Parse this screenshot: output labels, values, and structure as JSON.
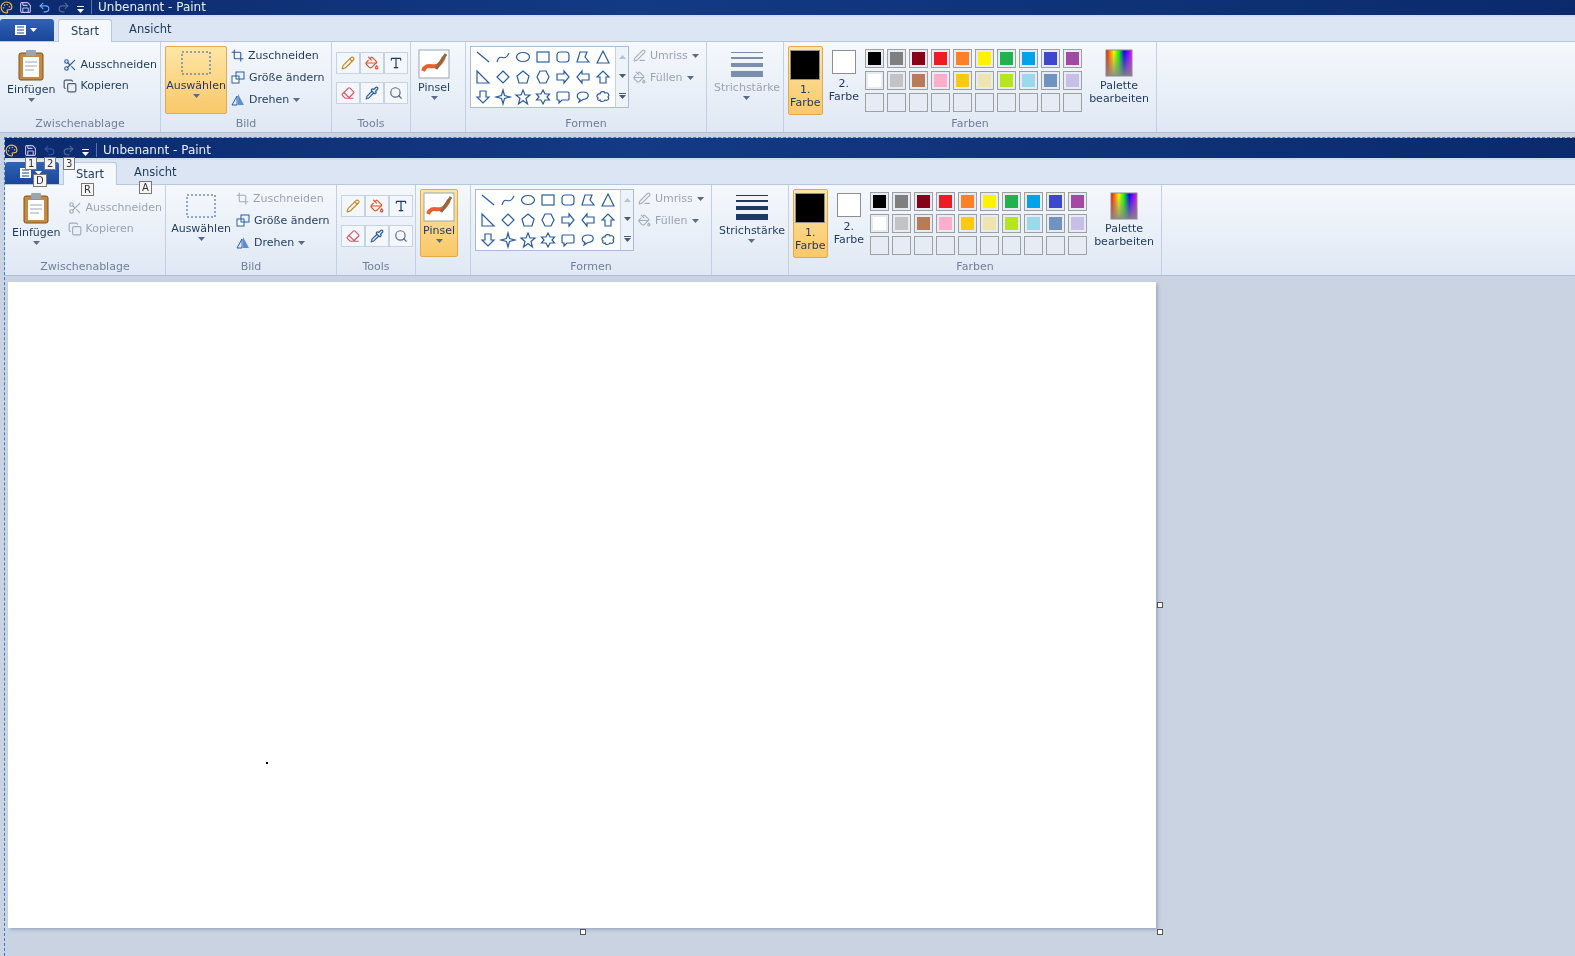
{
  "ribbons": [
    {
      "title": "Unbenannt - Paint",
      "qat": [
        {
          "kind": "save",
          "disabled": false
        },
        {
          "kind": "undo",
          "disabled": false
        },
        {
          "kind": "redo",
          "disabled": true
        }
      ],
      "tabs": [
        {
          "label": "Start",
          "selected": true
        },
        {
          "label": "Ansicht",
          "selected": false
        }
      ],
      "clipboard": {
        "label": "Zwischenablage",
        "paste": "Einfügen",
        "cut": {
          "label": "Ausschneiden",
          "disabled": false
        },
        "copy": {
          "label": "Kopieren",
          "disabled": false
        }
      },
      "image": {
        "label": "Bild",
        "select": {
          "label": "Auswählen",
          "selected": true
        },
        "crop": {
          "label": "Zuschneiden",
          "disabled": false
        },
        "resize": "Größe ändern",
        "rotate": "Drehen"
      },
      "tools": {
        "label": "Tools"
      },
      "brush": {
        "label": "Pinsel",
        "selected": false
      },
      "shapes": {
        "label": "Formen",
        "outline": {
          "label": "Umriss",
          "disabled": true
        },
        "fill": {
          "label": "Füllen",
          "disabled": true
        }
      },
      "size": {
        "label": "Strichstärke",
        "disabled": true
      },
      "colors": {
        "label": "Farben",
        "color1": {
          "label": "1. Farbe",
          "selected": true,
          "color": "#000000"
        },
        "color2": {
          "label": "2. Farbe",
          "selected": false,
          "color": "#ffffff"
        },
        "edit": "Palette bearbeiten"
      }
    },
    {
      "title": "Unbenannt - Paint",
      "qat": [
        {
          "kind": "save",
          "disabled": false,
          "keytip": "1"
        },
        {
          "kind": "undo",
          "disabled": true,
          "keytip": "2"
        },
        {
          "kind": "redo",
          "disabled": true,
          "keytip": "3"
        }
      ],
      "file_keytip": "D",
      "tabs": [
        {
          "label": "Start",
          "selected": true,
          "keytip": "R"
        },
        {
          "label": "Ansicht",
          "selected": false,
          "keytip": "A"
        }
      ],
      "clipboard": {
        "label": "Zwischenablage",
        "paste": "Einfügen",
        "cut": {
          "label": "Ausschneiden",
          "disabled": true
        },
        "copy": {
          "label": "Kopieren",
          "disabled": true
        }
      },
      "image": {
        "label": "Bild",
        "select": {
          "label": "Auswählen",
          "selected": false
        },
        "crop": {
          "label": "Zuschneiden",
          "disabled": true
        },
        "resize": "Größe ändern",
        "rotate": "Drehen"
      },
      "tools": {
        "label": "Tools"
      },
      "brush": {
        "label": "Pinsel",
        "selected": true
      },
      "shapes": {
        "label": "Formen",
        "outline": {
          "label": "Umriss",
          "disabled": true
        },
        "fill": {
          "label": "Füllen",
          "disabled": true
        }
      },
      "size": {
        "label": "Strichstärke",
        "disabled": false
      },
      "colors": {
        "label": "Farben",
        "color1": {
          "label": "1. Farbe",
          "selected": true,
          "color": "#000000"
        },
        "color2": {
          "label": "2. Farbe",
          "selected": false,
          "color": "#ffffff"
        },
        "edit": "Palette bearbeiten"
      }
    }
  ],
  "palette": [
    {
      "color": "#000000"
    },
    {
      "color": "#7f7f7f"
    },
    {
      "color": "#880015"
    },
    {
      "color": "#ed1c24"
    },
    {
      "color": "#ff7f27"
    },
    {
      "color": "#fff200"
    },
    {
      "color": "#22b14c"
    },
    {
      "color": "#00a2e8"
    },
    {
      "color": "#3f48cc"
    },
    {
      "color": "#a349a4"
    },
    {
      "color": "#ffffff"
    },
    {
      "color": "#c3c3c3"
    },
    {
      "color": "#b97a57"
    },
    {
      "color": "#ffaec9"
    },
    {
      "color": "#ffc90e"
    },
    {
      "color": "#efe4b0"
    },
    {
      "color": "#b5e61d"
    },
    {
      "color": "#99d9ea"
    },
    {
      "color": "#7092be"
    },
    {
      "color": "#c8bfe7"
    }
  ]
}
